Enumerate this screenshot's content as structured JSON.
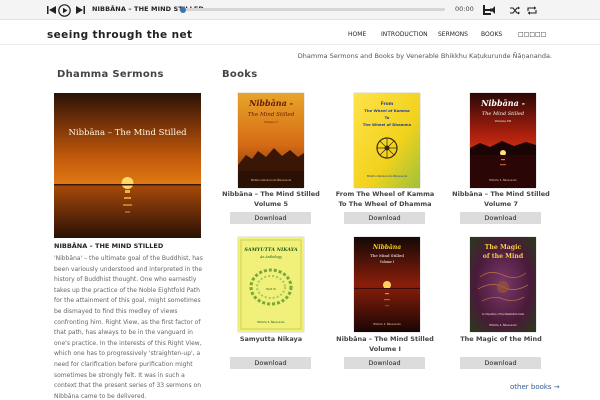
{
  "player": {
    "track_title": "NIBBĀNA – THE MIND STILLED",
    "time": "00:00",
    "progress": 0
  },
  "header": {
    "site_title": "seeing through the net",
    "nav": [
      "HOME",
      "INTRODUCTION",
      "SERMONS",
      "BOOKS",
      "□□□□□"
    ],
    "tagline": "Dhamma Sermons and Books by Venerable Bhikkhu Kaṭukurunde Ñāṇananda."
  },
  "sermons": {
    "heading": "Dhamma Sermons",
    "feature_image_title": "Nibbāna – The Mind Stilled",
    "title": "NIBBĀNA – THE MIND STILLED",
    "lines": [
      "'Nibbāna' – the ultimate goal of the Buddhist, has",
      "been variously understood and interpreted in the",
      "history of Buddhist thought. One who earnestly",
      "takes up the practice of the Noble Eightfold Path",
      "for the attainment of this goal, might sometimes",
      "be dismayed to find this medley of views",
      "confronting him. Right View, as the first factor of",
      "that path, has always to be in the vanguard in",
      "one's practice. In the interests of this Right View,",
      "which one has to progressively 'straighten-up', a",
      "need for clarification before purification might",
      "sometimes be strongly felt. It was in such a",
      "context that the present series of 33 sermons on",
      "Nibbāna came to be delivered."
    ]
  },
  "books": {
    "heading": "Books",
    "download_label": "Download",
    "items": [
      {
        "title_lines": [
          "Nibbāna – The Mind Stilled",
          "Volume 5"
        ],
        "cover_title": "Nibbāna -",
        "cover_subtitle": "The Mind Stilled",
        "cover_volume": "Volume V",
        "cover_author": "Bhikkhu Katukurunde Ñāṇananda"
      },
      {
        "title_lines": [
          "From The Wheel of Kamma",
          "To The Wheel of Dhamma"
        ],
        "cover_title": "From",
        "cover_subtitle": "The Wheel of Kamma",
        "cover_to": "To",
        "cover_volume": "The Wheel of Dhamma",
        "cover_author": "Bhikkhu Katukurunde Ñāṇananda"
      },
      {
        "title_lines": [
          "Nibbāna – The Mind Stilled",
          "Volume 7"
        ],
        "cover_title": "Nibbāna -",
        "cover_subtitle": "The Mind Stilled",
        "cover_volume": "Volume VII",
        "cover_author": "Bhikkhu K. Ñāṇananda"
      },
      {
        "title_lines": [
          "Samyutta Nikaya"
        ],
        "cover_title": "SAMYUTTA NIKAYA",
        "cover_subtitle": "An Anthology",
        "cover_volume": "Part III",
        "cover_author": "Bhikkhu K. Ñāṇananda"
      },
      {
        "title_lines": [
          "Nibbāna – The Mind Stilled",
          "Volume I"
        ],
        "cover_title": "Nibbāna",
        "cover_subtitle": "The Mind Stilled",
        "cover_volume": "Volume I",
        "cover_author": "Bhikkhu K. Ñāṇananda"
      },
      {
        "title_lines": [
          "The Magic of the Mind"
        ],
        "cover_title": "The Magic",
        "cover_subtitle": "of the Mind",
        "cover_volume": "An Exposition of the Kālakārāma Sutta",
        "cover_author": "Bhikkhu K. Ñāṇananda"
      }
    ]
  },
  "other_books": "other books →",
  "colors": {
    "link": "#2f5d95",
    "progress_knob": "#3a76b0",
    "download_bg": "#dcdcdc"
  },
  "icons": {
    "prev": "skip-back-icon",
    "play": "play-circle-icon",
    "next": "skip-forward-icon",
    "playlist": "playlist-icon",
    "volume": "volume-icon",
    "shuffle": "shuffle-icon",
    "repeat": "repeat-icon"
  }
}
